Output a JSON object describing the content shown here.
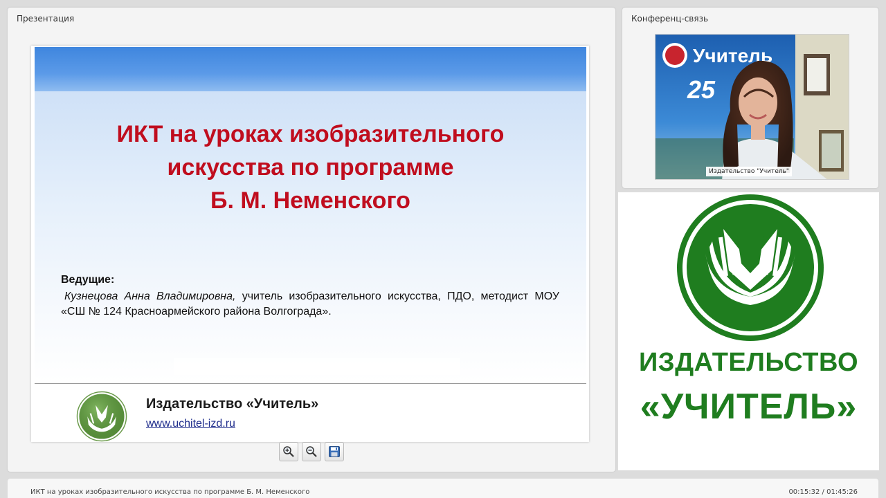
{
  "presentation_panel": {
    "title": "Презентация"
  },
  "conference_panel": {
    "title": "Конференц-связь"
  },
  "slide": {
    "title_lines": [
      "ИКТ на уроках изобразительного",
      "искусства по программе",
      "Б. М. Неменского"
    ],
    "hosts_label": "Ведущие:",
    "host_name": "Кузнецова Анна Владимировна,",
    "host_desc": " учитель изобразительного искусства, ПДО, методист МОУ «СШ № 124 Красноармейского района Волгограда».",
    "footer_name": "Издательство «Учитель»",
    "footer_url": "www.uchitel-izd.ru",
    "title_color": "#c00d1e"
  },
  "toolbar": {
    "zoom_in_icon": "zoom-in-icon",
    "zoom_out_icon": "zoom-out-icon",
    "save_icon": "save-icon"
  },
  "webcam": {
    "label": "Издательство \"Учитель\"",
    "backdrop_text": "Учитель",
    "backdrop_number": "25"
  },
  "logo_panel": {
    "line1": "ИЗДАТЕЛЬСТВО",
    "line2": "«УЧИТЕЛЬ»",
    "brand_color": "#1f7d1f"
  },
  "status_bar": {
    "title": "ИКТ на уроках изобразительного искусства по программе Б. М. Неменского",
    "time": "00:15:32 / 01:45:26"
  }
}
